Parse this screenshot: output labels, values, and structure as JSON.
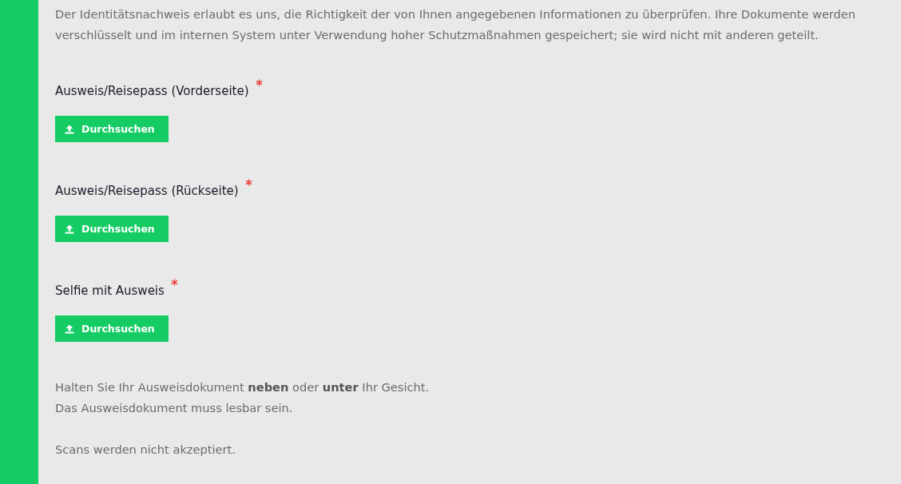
{
  "intro": "Der Identitätsnachweis erlaubt es uns, die Richtigkeit der von Ihnen angegebenen Informationen zu überprüfen. Ihre Dokumente werden verschlüsselt und im internen System unter Verwendung hoher Schutzmaßnahmen gespeichert; sie wird nicht mit anderen geteilt.",
  "fields": [
    {
      "label": "Ausweis/Reisepass (Vorderseite)",
      "required": true,
      "button": "Durchsuchen"
    },
    {
      "label": "Ausweis/Reisepass (Rückseite)",
      "required": true,
      "button": "Durchsuchen"
    },
    {
      "label": "Selfie mit Ausweis",
      "required": true,
      "button": "Durchsuchen"
    }
  ],
  "notes": [
    "Halten Sie Ihr Ausweisdokument **neben** oder **unter** Ihr Gesicht.",
    "Das Ausweisdokument muss lesbar sein.",
    "Scans werden nicht akzeptiert."
  ]
}
